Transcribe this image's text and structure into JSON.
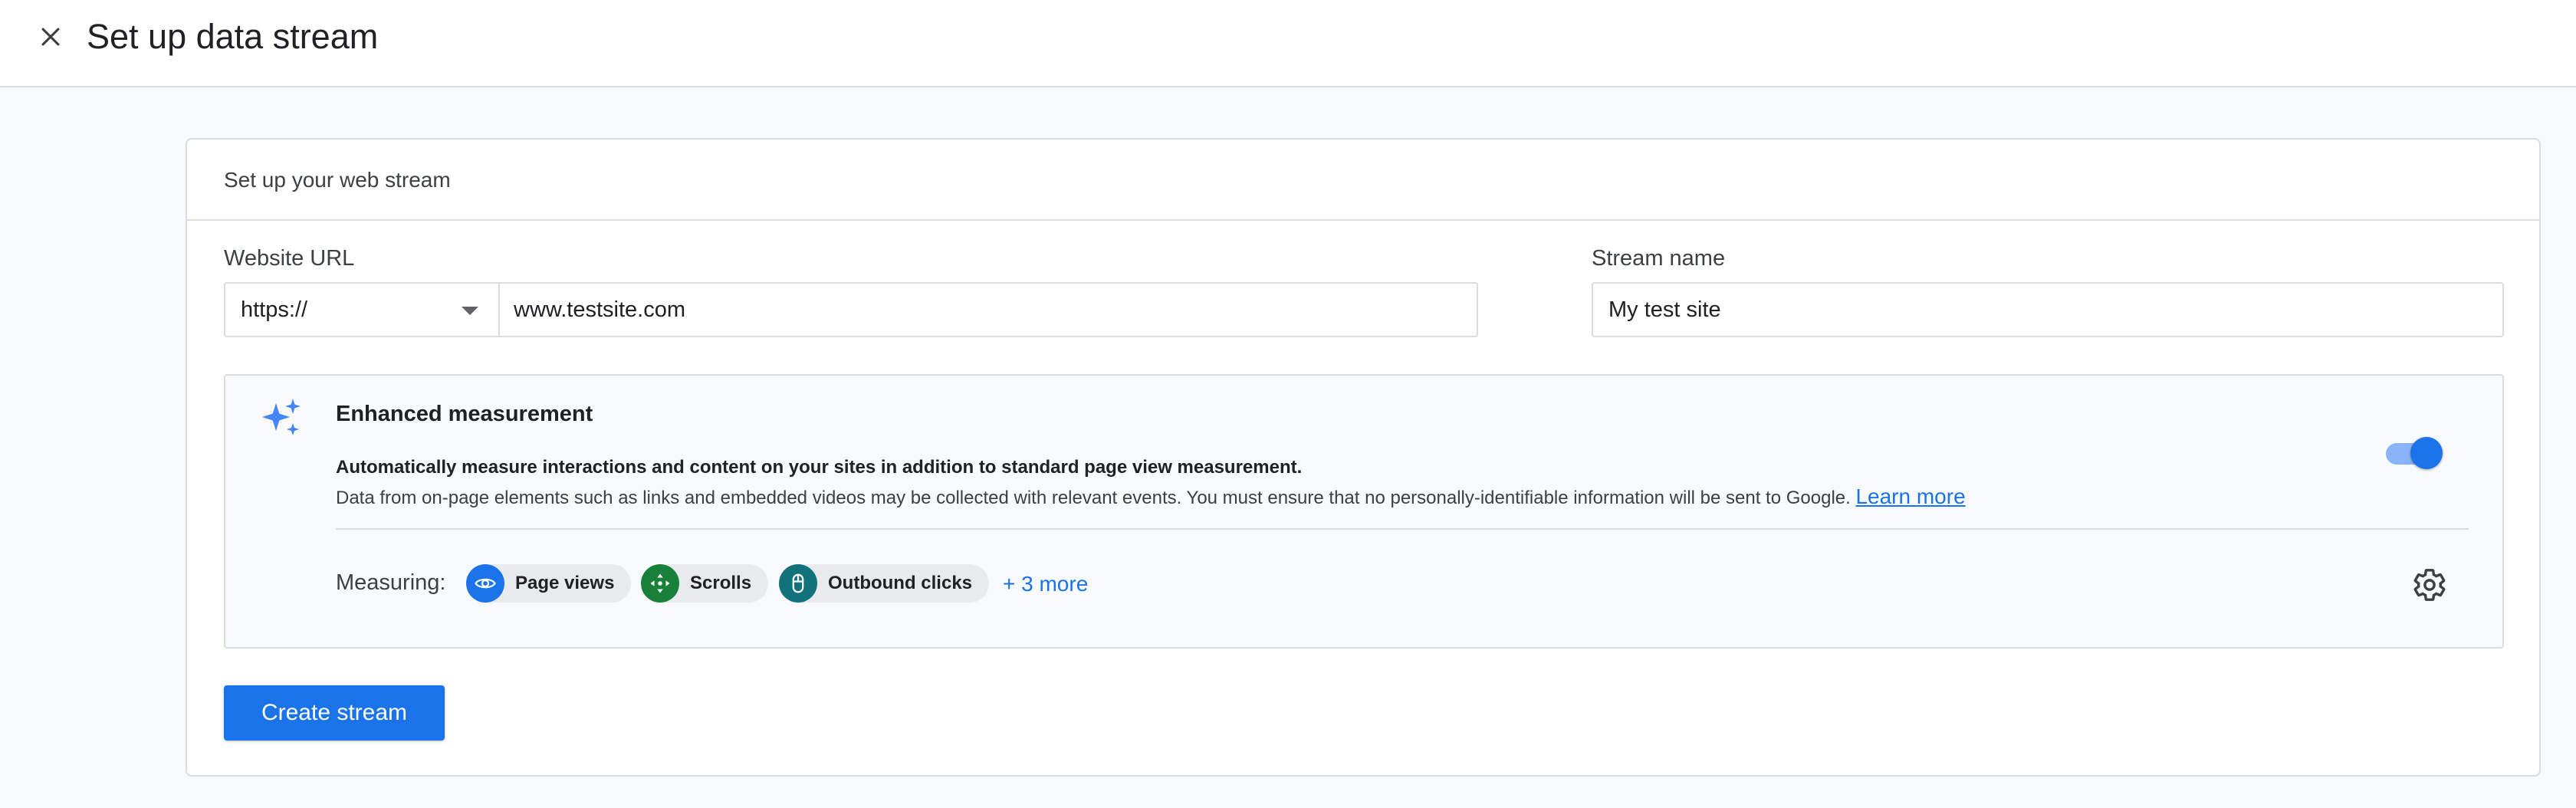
{
  "header": {
    "title": "Set up data stream",
    "close_icon": "close-icon"
  },
  "card": {
    "title": "Set up your web stream",
    "website_url": {
      "label": "Website URL",
      "protocol": "https://",
      "value": "www.testsite.com"
    },
    "stream_name": {
      "label": "Stream name",
      "value": "My test site"
    },
    "enhanced_measurement": {
      "title": "Enhanced measurement",
      "description_bold": "Automatically measure interactions and content on your sites in addition to standard page view measurement.",
      "description": "Data from on-page elements such as links and embedded videos may be collected with relevant events. You must ensure that no personally-identifiable information will be sent to Google.",
      "learn_more": "Learn more",
      "enabled": true,
      "measuring_label": "Measuring:",
      "chips": [
        {
          "label": "Page views",
          "icon": "eye-icon",
          "color": "#1a73e8"
        },
        {
          "label": "Scrolls",
          "icon": "scroll-arrows-icon",
          "color": "#188038"
        },
        {
          "label": "Outbound clicks",
          "icon": "mouse-icon",
          "color": "#12727c"
        }
      ],
      "more_link": "+ 3 more"
    },
    "create_button": "Create stream"
  },
  "colors": {
    "accent": "#1a73e8",
    "toggle_track": "#8ab4f8"
  }
}
